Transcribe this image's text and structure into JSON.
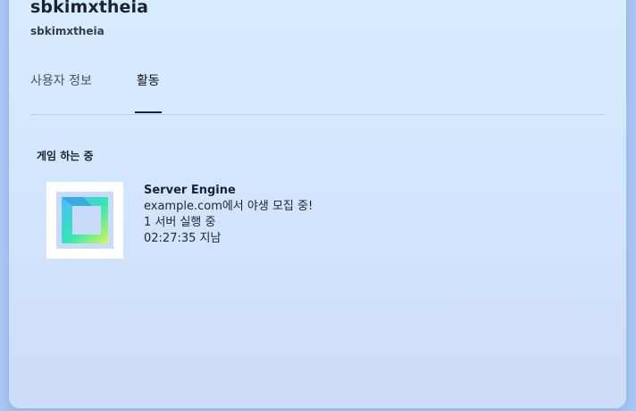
{
  "profile": {
    "display_name": "sbkimxtheia",
    "username": "sbkimxtheia"
  },
  "tabs": [
    {
      "label": "사용자 정보",
      "active": false
    },
    {
      "label": "활동",
      "active": true
    }
  ],
  "activity_section": {
    "title": "게임 하는 중",
    "game": {
      "name": "Server Engine",
      "details": "example.com에서 야생 모집 중!",
      "state": "1 서버 실행 중",
      "elapsed": "02:27:35 지남",
      "icon": "server-engine-logo-icon"
    }
  },
  "colors": {
    "accent_dark": "#1b2330",
    "card_top": "#d8ecff",
    "card_bottom": "#cddcf8",
    "logo_gradient": [
      "#4fb8ff",
      "#38e6b0",
      "#d8f65a"
    ]
  }
}
